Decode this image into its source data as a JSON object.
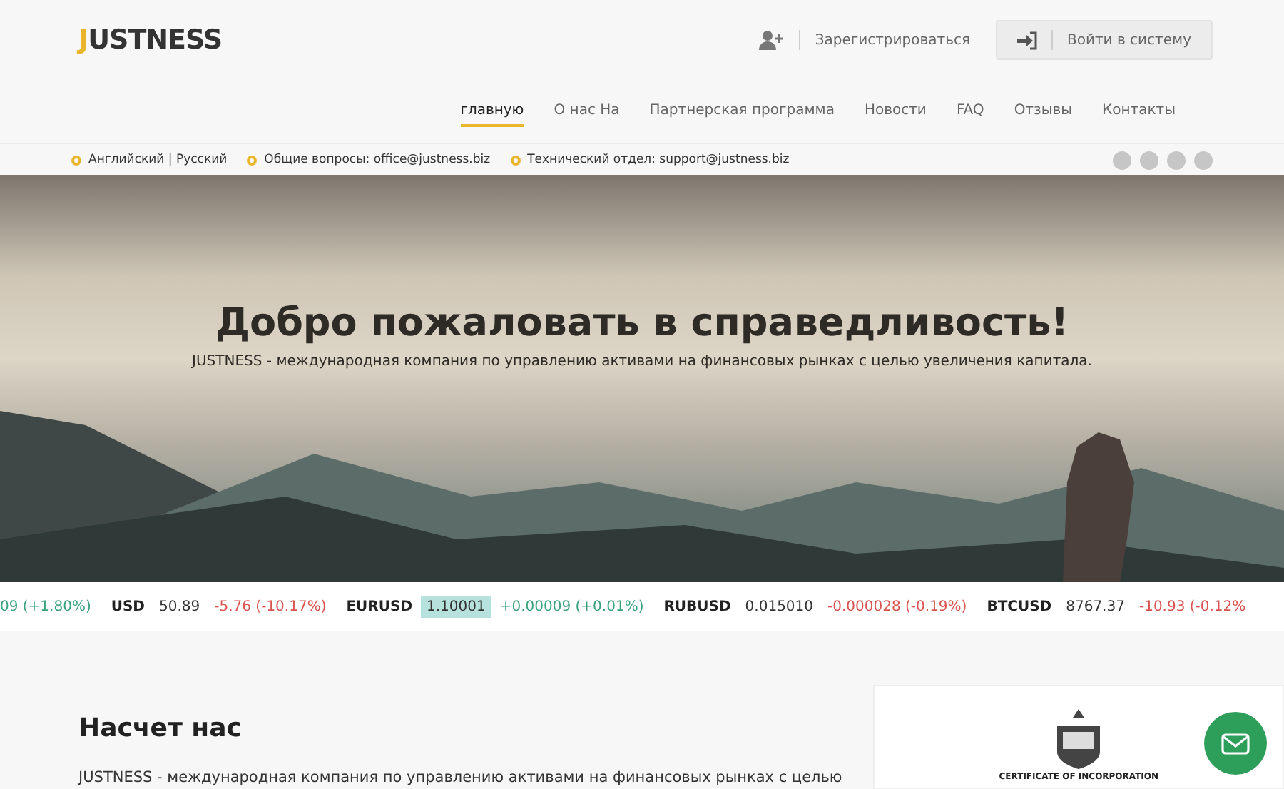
{
  "logo": {
    "initial": "J",
    "rest": "USTNESS"
  },
  "auth": {
    "register": "Зарегистрироваться",
    "login": "Войти в систему"
  },
  "nav": [
    {
      "label": "главную",
      "selected": true
    },
    {
      "label": "О нас На",
      "selected": false
    },
    {
      "label": "Партнерская программа",
      "selected": false
    },
    {
      "label": "Новости",
      "selected": false
    },
    {
      "label": "FAQ",
      "selected": false
    },
    {
      "label": "Отзывы",
      "selected": false
    },
    {
      "label": "Контакты",
      "selected": false
    }
  ],
  "info_bar": [
    {
      "text": "Английский | Русский"
    },
    {
      "text": "Общие вопросы: office@justness.biz"
    },
    {
      "text": "Технический отдел: support@justness.biz"
    }
  ],
  "hero": {
    "title": "Добро пожаловать в справедливость!",
    "subtitle": "JUSTNESS - международная компания по управлению активами на финансовых рынках с целью увеличения капитала."
  },
  "ticker": [
    {
      "change": "09 (+1.80%)",
      "rising": true
    },
    {
      "symbol": "USD",
      "price": "50.89",
      "change": "-5.76 (-10.17%)",
      "rising": false,
      "highlighted": false
    },
    {
      "symbol": "EURUSD",
      "price": "1.10001",
      "change": "+0.00009 (+0.01%)",
      "rising": true,
      "highlighted": true
    },
    {
      "symbol": "RUBUSD",
      "price": "0.015010",
      "change": "-0.000028 (-0.19%)",
      "rising": false,
      "highlighted": false
    },
    {
      "symbol": "BTCUSD",
      "price": "8767.37",
      "change": "-10.93 (-0.12%",
      "rising": false,
      "highlighted": false
    }
  ],
  "about": {
    "title": "Насчет нас",
    "text": "JUSTNESS - международная компания по управлению активами на финансовых рынках с целью",
    "certificate": "CERTIFICATE OF INCORPORATION"
  }
}
